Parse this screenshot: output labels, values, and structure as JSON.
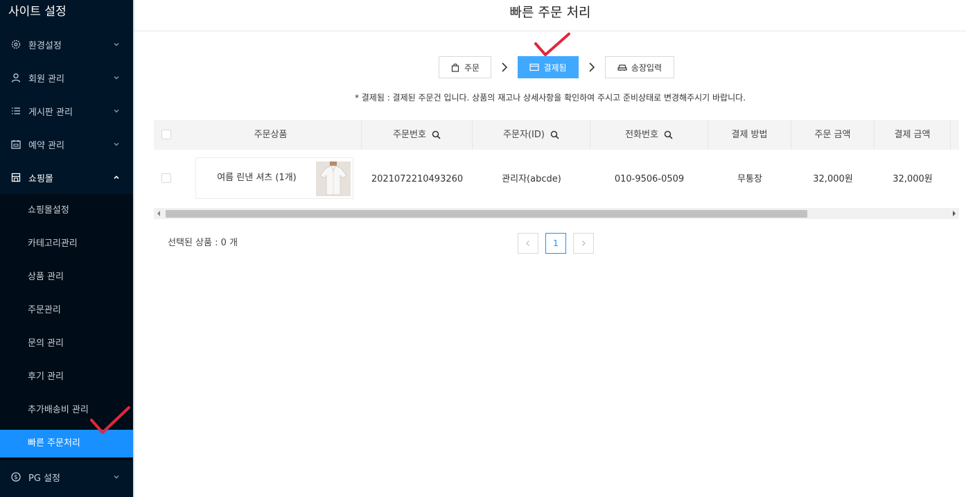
{
  "sidebar": {
    "title": "사이트 설정",
    "items": [
      {
        "label": "환경설정",
        "icon": "gear-icon"
      },
      {
        "label": "회원 관리",
        "icon": "user-icon"
      },
      {
        "label": "게시판 관리",
        "icon": "list-icon"
      },
      {
        "label": "예약 관리",
        "icon": "calendar-icon"
      },
      {
        "label": "쇼핑몰",
        "icon": "shop-icon"
      }
    ],
    "shop_sub": [
      {
        "label": "쇼핑몰설정"
      },
      {
        "label": "카테고리관리"
      },
      {
        "label": "상품 관리"
      },
      {
        "label": "주문관리"
      },
      {
        "label": "문의 관리"
      },
      {
        "label": "후기 관리"
      },
      {
        "label": "추가배송비 관리"
      },
      {
        "label": "빠른 주문처리",
        "active": true
      }
    ],
    "pg": {
      "label": "PG 설정",
      "icon": "dollar-icon"
    }
  },
  "page": {
    "title": "빠른 주문 처리"
  },
  "steps": [
    {
      "label": "주문",
      "icon": "bag-icon"
    },
    {
      "label": "결제됨",
      "icon": "card-icon",
      "active": true
    },
    {
      "label": "송장입력",
      "icon": "truck-icon"
    }
  ],
  "notice": "* 결제됨 : 결제된 주문건 입니다. 상품의 재고나 상세사항을 확인하여 주시고 준비상태로 변경해주시기 바랍니다.",
  "table": {
    "columns": [
      "주문상품",
      "주문번호",
      "주문자(ID)",
      "전화번호",
      "결제 방법",
      "주문 금액",
      "결제 금액"
    ],
    "rows": [
      {
        "product": "여름 린낸 셔츠 (1개)",
        "order_no": "2021072210493260",
        "orderer": "관리자(abcde)",
        "phone": "010-9506-0509",
        "pay_method": "무통장",
        "order_amount": "32,000원",
        "pay_amount": "32,000원"
      }
    ]
  },
  "selected_count": "선택된 상품 : 0 개",
  "pagination": {
    "current": "1"
  },
  "colors": {
    "sidebar_bg": "#011528",
    "accent": "#1890ff",
    "step_active": "#40a9ff",
    "checkmark": "#e0283a"
  }
}
